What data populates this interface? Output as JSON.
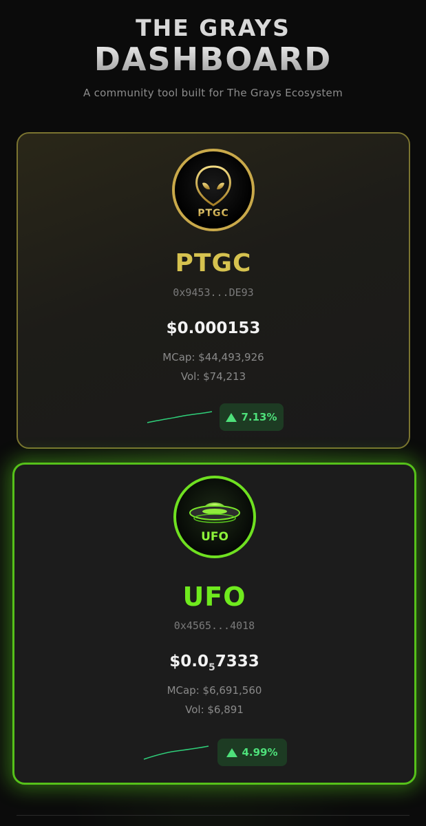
{
  "header": {
    "title_line1": "THE GRAYS",
    "title_line2": "DASHBOARD",
    "subtitle": "A community tool built for The Grays Ecosystem"
  },
  "tokens": [
    {
      "symbol": "PTGC",
      "logo_text": "PTGC",
      "logo_icon": "alien-head-icon",
      "address": "0x9453...DE93",
      "price": "$0.000153",
      "mcap": "MCap: $44,493,926",
      "volume": "Vol: $74,213",
      "change": "7.13%",
      "trend": "up",
      "accent": "#d6c24f"
    },
    {
      "symbol": "UFO",
      "logo_text": "UFO",
      "logo_icon": "flying-saucer-icon",
      "address": "0x4565...4018",
      "price_prefix": "$0.0",
      "price_sub": "5",
      "price_suffix": "7333",
      "mcap": "MCap: $6,691,560",
      "volume": "Vol: $6,891",
      "change": "4.99%",
      "trend": "up",
      "accent": "#6fea1e"
    }
  ],
  "colors": {
    "positive": "#4ee07a",
    "positive_bg": "#1d3b23"
  }
}
